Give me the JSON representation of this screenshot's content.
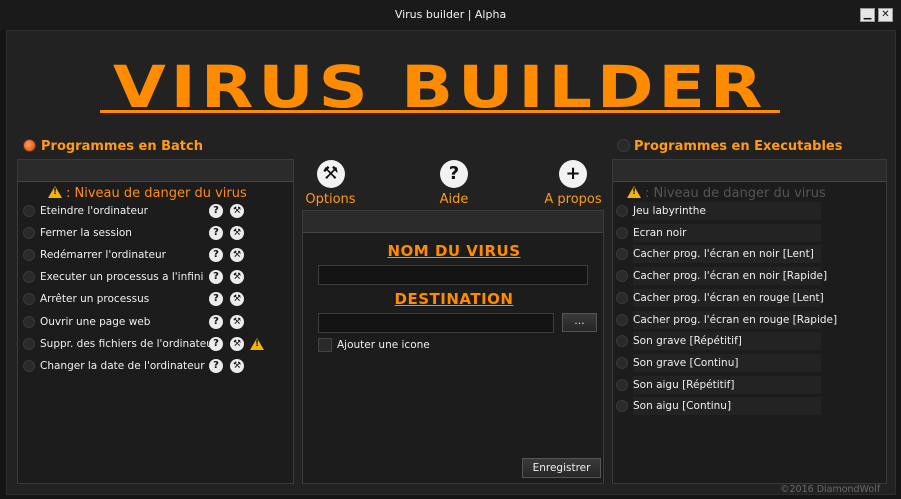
{
  "window": {
    "title": "Virus builder | Alpha",
    "minimize_label": "▁",
    "close_label": "✕"
  },
  "logo": {
    "text": "VIRUS BUILDER"
  },
  "batch": {
    "title": "Programmes en Batch",
    "danger_label": ": Niveau de danger du virus",
    "items": [
      {
        "label": "Eteindre l'ordinateur",
        "warning": false
      },
      {
        "label": "Fermer la session",
        "warning": false
      },
      {
        "label": "Redémarrer l'ordinateur",
        "warning": false
      },
      {
        "label": "Executer un processus a l'infini",
        "warning": false
      },
      {
        "label": "Arrêter un processus",
        "warning": false
      },
      {
        "label": "Ouvrir une page web",
        "warning": false
      },
      {
        "label": "Suppr. des fichiers de l'ordinateur",
        "warning": true
      },
      {
        "label": "Changer la date de l'ordinateur",
        "warning": false
      }
    ]
  },
  "exec": {
    "title": "Programmes en Executables",
    "danger_label": ": Niveau de danger du virus",
    "items": [
      "Jeu labyrinthe",
      "Ecran noir",
      "Cacher prog. l'écran en noir [Lent]",
      "Cacher prog. l'écran en noir [Rapide]",
      "Cacher prog. l'écran en rouge [Lent]",
      "Cacher prog. l'écran en rouge [Rapide]",
      "Son grave [Répétitif]",
      "Son grave [Continu]",
      "Son aigu [Répétitif]",
      "Son aigu [Continu]"
    ]
  },
  "toolbar": {
    "options_label": "Options",
    "help_label": "Aide",
    "about_label": "A propos"
  },
  "form": {
    "name_label": "NOM DU VIRUS",
    "name_value": "",
    "destination_label": "DESTINATION",
    "destination_value": "",
    "browse_label": "...",
    "add_icon_label": "Ajouter une icone",
    "save_label": "Enregistrer"
  },
  "footer": {
    "text": "©2016 DiamondWolf"
  },
  "colors": {
    "accent": "#ff8c00",
    "background": "#222222",
    "panel": "#1c1c1c"
  }
}
